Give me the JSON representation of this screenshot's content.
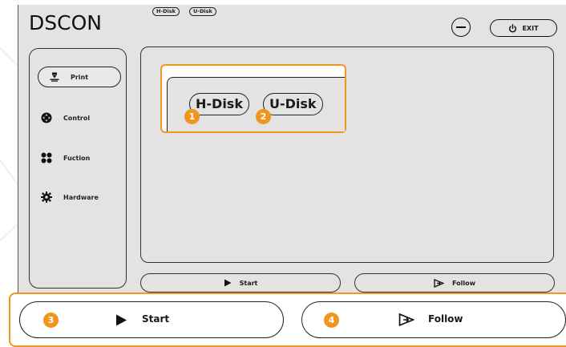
{
  "app": {
    "logo": "DSCON",
    "exit_label": "EXIT"
  },
  "sidebar": {
    "items": [
      {
        "label": "Print",
        "icon": "print-nozzle-icon",
        "active": true
      },
      {
        "label": "Control",
        "icon": "control-dpad-icon",
        "active": false
      },
      {
        "label": "Fuction",
        "icon": "function-grid-icon",
        "active": false
      },
      {
        "label": "Hardware",
        "icon": "hardware-gear-icon",
        "active": false
      }
    ]
  },
  "main": {
    "tabs": [
      "H-Disk",
      "U-Disk"
    ],
    "zoom_tabs": [
      "H-Disk",
      "U-Disk"
    ],
    "start_label": "Start",
    "follow_label": "Follow"
  },
  "callouts": {
    "badges": [
      "1",
      "2",
      "3",
      "4"
    ],
    "start_label": "Start",
    "follow_label": "Follow"
  },
  "colors": {
    "accent": "#f0961e",
    "screen_bg": "#e3e3e3",
    "ink": "#1a1a1a"
  }
}
